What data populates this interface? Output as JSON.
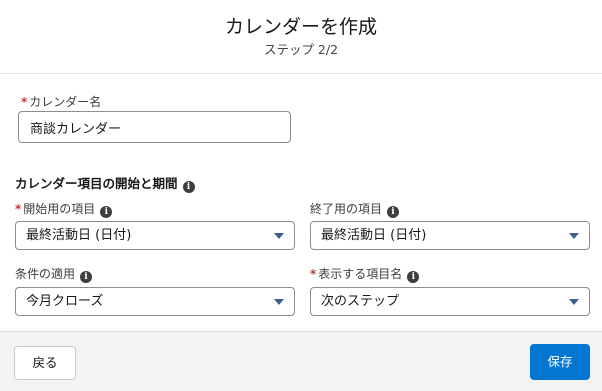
{
  "header": {
    "title": "カレンダーを作成",
    "subtitle": "ステップ 2/2"
  },
  "calendar_name": {
    "required_mark": "*",
    "label": "カレンダー名",
    "value": "商談カレンダー"
  },
  "section": {
    "title": "カレンダー項目の開始と期間",
    "info_icon": "info-icon"
  },
  "fields": {
    "start_field": {
      "required_mark": "*",
      "label": "開始用の項目",
      "value": "最終活動日 (日付)"
    },
    "end_field": {
      "label": "終了用の項目",
      "value": "最終活動日 (日付)"
    },
    "filter": {
      "label": "条件の適用",
      "value": "今月クローズ"
    },
    "display_field": {
      "required_mark": "*",
      "label": "表示する項目名",
      "value": "次のステップ"
    }
  },
  "footer": {
    "back_label": "戻る",
    "save_label": "保存"
  },
  "colors": {
    "primary": "#0176d3",
    "required": "#c23934"
  }
}
